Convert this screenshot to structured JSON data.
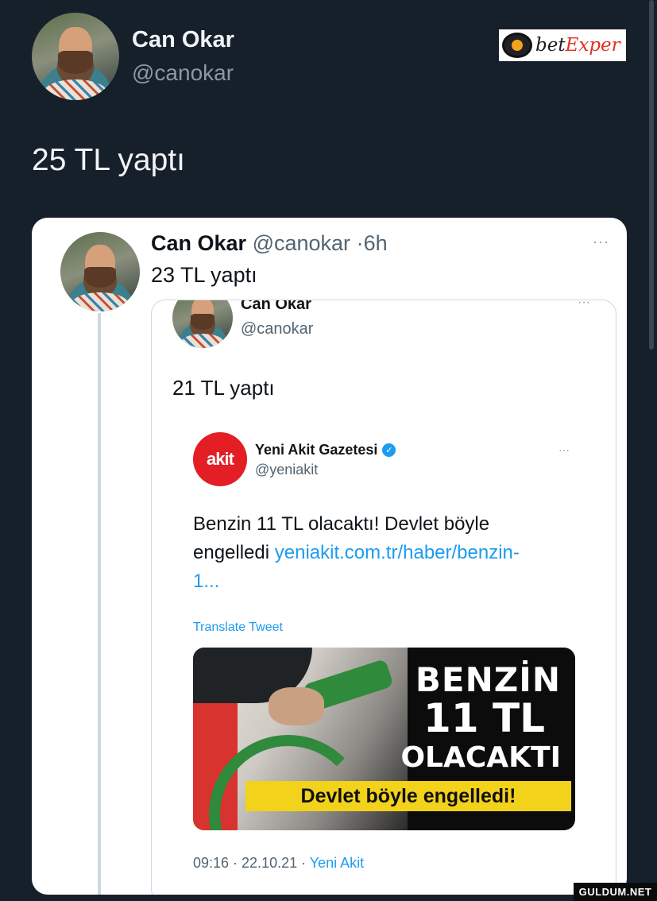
{
  "top_tweet": {
    "name": "Can Okar",
    "handle": "@canokar",
    "text": "25 TL yaptı"
  },
  "ad_logo": {
    "brand_part1": "bet",
    "brand_part2": "Exper"
  },
  "quoted_tweet": {
    "name": "Can Okar",
    "handle": "@canokar",
    "separator": "·",
    "time": "6h",
    "text": "23 TL yaptı",
    "more": "···"
  },
  "nested_tweet": {
    "name": "Can Okar",
    "handle": "@canokar",
    "text": "21 TL yaptı",
    "more": "···"
  },
  "akit_tweet": {
    "avatar_text": "akit",
    "name": "Yeni Akit Gazetesi",
    "handle": "@yeniakit",
    "body": "Benzin 11 TL olacaktı! Devlet böyle engelledi ",
    "link": "yeniakit.com.tr/haber/benzin-1...",
    "translate": "Translate Tweet",
    "image_line1": "BENZİN",
    "image_line2": "11 TL",
    "image_line3": "OLACAKTI",
    "image_banner": "Devlet böyle engelledi!",
    "footer_time": "09:16 · 22.10.21 · ",
    "footer_source": "Yeni Akit",
    "more": "···"
  },
  "watermark": "GULDUM.NET",
  "colors": {
    "background": "#16202b",
    "link": "#1d9bf0",
    "akit_red": "#e31e24",
    "banner_yellow": "#f2d21b"
  }
}
